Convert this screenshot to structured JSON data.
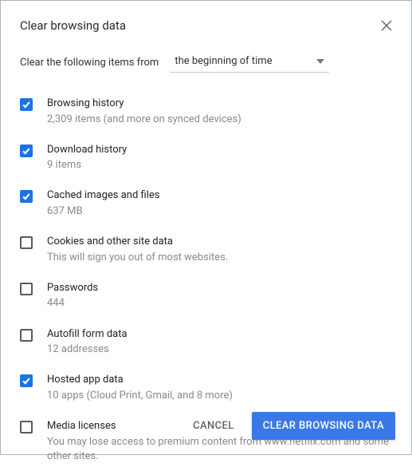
{
  "dialog": {
    "title": "Clear browsing data",
    "range_label": "Clear the following items from",
    "range_value": "the beginning of time"
  },
  "items": [
    {
      "title": "Browsing history",
      "subtitle": "2,309 items (and more on synced devices)",
      "checked": true
    },
    {
      "title": "Download history",
      "subtitle": "9 items",
      "checked": true
    },
    {
      "title": "Cached images and files",
      "subtitle": "637 MB",
      "checked": true
    },
    {
      "title": "Cookies and other site data",
      "subtitle": "This will sign you out of most websites.",
      "checked": false
    },
    {
      "title": "Passwords",
      "subtitle": "444",
      "checked": false
    },
    {
      "title": "Autofill form data",
      "subtitle": "12 addresses",
      "checked": false
    },
    {
      "title": "Hosted app data",
      "subtitle": "10 apps (Cloud Print, Gmail, and 8 more)",
      "checked": true
    },
    {
      "title": "Media licenses",
      "subtitle": "You may lose access to premium content from www.netflix.com and some other sites.",
      "checked": false
    }
  ],
  "actions": {
    "cancel": "CANCEL",
    "clear": "CLEAR BROWSING DATA"
  }
}
